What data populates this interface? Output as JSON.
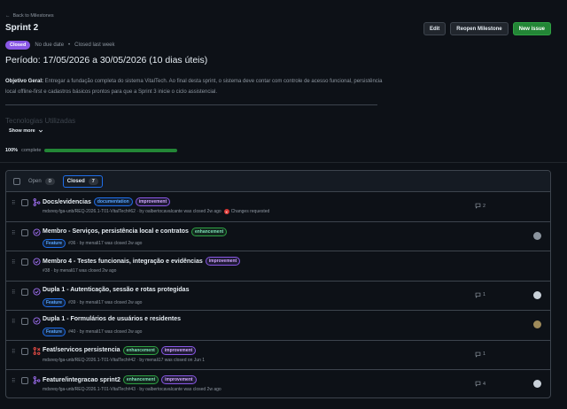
{
  "back_link": "Back to Milestones",
  "title": "Sprint 2",
  "header_buttons": {
    "edit": "Edit",
    "reopen": "Reopen Milestone",
    "new_issue": "New issue"
  },
  "meta": {
    "status": "Closed",
    "due": "No due date",
    "separator": "•",
    "closed": "Closed last week"
  },
  "period": "Período: 17/05/2026 a 30/05/2026 (10 dias úteis)",
  "description": {
    "label": "Objetivo Geral:",
    "text": " Entregar a fundação completa do sistema VitalTech. Ao final desta sprint, o sistema deve contar com controle de acesso funcional, persistência local offline-first e cadastros básicos prontos para que a Sprint 3 inicie o ciclo assistencial."
  },
  "faded_heading": "Tecnologias Utilizadas",
  "show_more": "Show more",
  "progress": {
    "percent_label": "100%",
    "suffix": "complete",
    "value": 1.0,
    "color": "#238636"
  },
  "tabs": {
    "open_label": "Open",
    "open_count": "0",
    "closed_label": "Closed",
    "closed_count": "7"
  },
  "colors": {
    "pr_merged": "#a371f7",
    "issue_closed": "#a371f7",
    "pr_closed": "#f85149"
  },
  "items": [
    {
      "icon": "pull-request-merged-icon",
      "title": "Docs/evidencias",
      "labels": [
        {
          "text": "documentation",
          "kind": "doc"
        },
        {
          "text": "improvement",
          "kind": "imp"
        }
      ],
      "sub_tag": "",
      "sub": "mdsreq-fga-unb/REQ-2026.1-T01-VitalTech#62 · by oalbertocavalcante was closed 2w ago",
      "review": "Changes requested",
      "comments": "2",
      "avatar": ""
    },
    {
      "icon": "issue-closed-icon",
      "title": "Membro - Serviços, persistência local e contratos",
      "labels": [
        {
          "text": "enhancement",
          "kind": "enh"
        }
      ],
      "sub_tag": "Feature",
      "sub": "#36 · by menali17 was closed 2w ago",
      "review": "",
      "comments": "",
      "avatar": "#8b949e"
    },
    {
      "icon": "issue-closed-icon",
      "title": "Membro 4 - Testes funcionais, integração e evidências",
      "labels": [
        {
          "text": "improvement",
          "kind": "imp"
        }
      ],
      "sub_tag": "",
      "sub": "#38 · by menali17 was closed 2w ago",
      "review": "",
      "comments": "",
      "avatar": ""
    },
    {
      "icon": "issue-closed-icon",
      "title": "Dupla 1 - Autenticação, sessão e rotas protegidas",
      "labels": [],
      "sub_tag": "Feature",
      "sub": "#39 · by menali17 was closed 2w ago",
      "review": "",
      "comments": "1",
      "avatar": "#c9d1d9"
    },
    {
      "icon": "issue-closed-icon",
      "title": "Dupla 1 - Formulários de usuários e residentes",
      "labels": [],
      "sub_tag": "Feature",
      "sub": "#40 · by menali17 was closed 2w ago",
      "review": "",
      "comments": "",
      "avatar": "#9e8a5a"
    },
    {
      "icon": "pull-request-closed-icon",
      "title": "Feat/servicos persistencia",
      "labels": [
        {
          "text": "enhancement",
          "kind": "enh"
        },
        {
          "text": "improvement",
          "kind": "imp"
        }
      ],
      "sub_tag": "",
      "sub": "mdsreq-fga-unb/REQ-2026.1-T01-VitalTech#42 · by menali17 was closed on Jun 1",
      "review": "",
      "comments": "1",
      "avatar": ""
    },
    {
      "icon": "pull-request-merged-icon",
      "title": "Feature/integracao sprint2",
      "labels": [
        {
          "text": "enhancement",
          "kind": "enh"
        },
        {
          "text": "improvement",
          "kind": "imp"
        }
      ],
      "sub_tag": "",
      "sub": "mdsreq-fga-unb/REQ-2026.1-T01-VitalTech#43 · by oalbertocavalcante was closed 2w ago",
      "review": "",
      "comments": "4",
      "avatar": "#c9d1d9"
    }
  ]
}
